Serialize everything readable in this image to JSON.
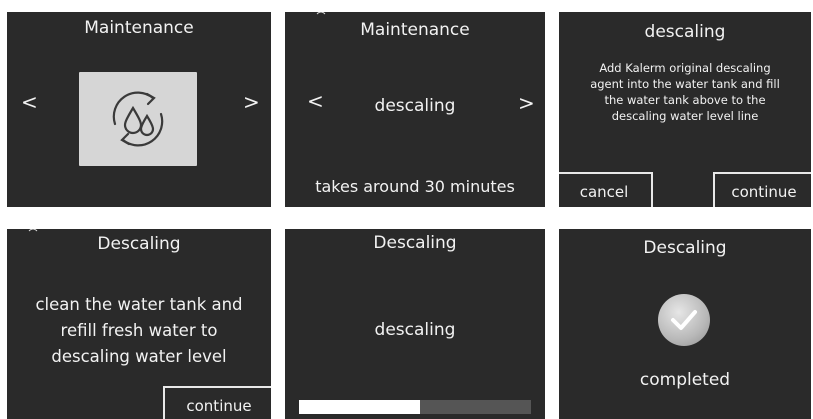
{
  "panels": [
    {
      "title": "Maintenance",
      "left_arrow": "<",
      "right_arrow": ">",
      "icon": "descaling-drops-cycle-icon"
    },
    {
      "title": "Maintenance",
      "left_arrow": "<",
      "right_arrow": ">",
      "option": "descaling",
      "duration_text": "takes around 30 minutes"
    },
    {
      "title": "descaling",
      "instruction_lines": [
        "Add Kalerm original descaling",
        "agent into the water tank and fill",
        "the water tank above to the",
        "descaling water level line"
      ],
      "cancel_label": "cancel",
      "continue_label": "continue"
    },
    {
      "title": "Descaling",
      "instruction_lines": [
        "clean the water tank and",
        "refill fresh water to",
        "descaling water level"
      ],
      "continue_label": "continue"
    },
    {
      "title": "Descaling",
      "status": "descaling",
      "progress_fraction": 0.52
    },
    {
      "title": "Descaling",
      "icon": "checkmark-icon",
      "status": "completed"
    }
  ]
}
